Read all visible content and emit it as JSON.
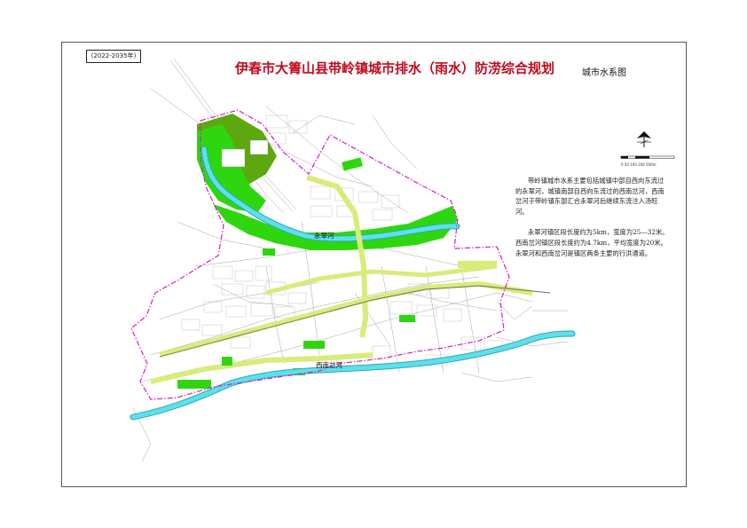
{
  "title": "伊春市大箐山县带岭镇城市排水（雨水）防涝综合规划",
  "period": "(2022-2035年)",
  "map_name": "城市水系图",
  "description": [
    "带岭镇城市水系主要包括城镇中部自西向东流过的永翠河，城镇南部自西向东流过的西南岔河，西南岔河于带岭镇东部汇合永翠河后继续东流注入汤旺河。",
    "永翠河镇区段长度约为5km，宽度为25—32米。西南岔河镇区段长度约为4.7km，平均宽度为20米。永翠河和西南岔河是镇区两条主要的行洪通道。"
  ],
  "rivers": {
    "yongcui": "永翠河",
    "xinancha": "西南岔河"
  },
  "scale_bar": {
    "labels": "0  50 100   200         500m"
  },
  "colors": {
    "title": "#c00a1e",
    "river": "#5ee0e8",
    "river_outline": "#2aa9b5",
    "green_space": "#2ed60f",
    "forest": "#5ea80f",
    "greenway": "#d8ec7a",
    "boundary": "#d21ec8",
    "streets": "#9a9a9a"
  }
}
